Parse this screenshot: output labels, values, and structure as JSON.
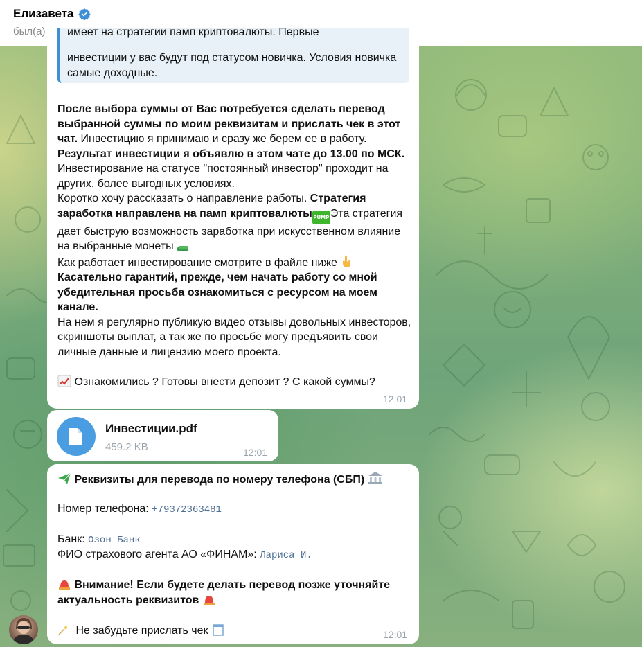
{
  "header": {
    "name": "Елизавета",
    "status": "был(а) недавно"
  },
  "message1": {
    "quote_cut_line": "имеет на стратегии памп криптовалюты. Первые",
    "quote_text": "инвестиции у вас будут под статусом новичка. Условия новичка самые доходные.",
    "p1_bold": "После выбора суммы от Вас потребуется сделать перевод выбранной суммы по моим реквизитам и прислать чек в этот чат.",
    "p1_rest": " Инвестицию я принимаю и сразу же берем ее в работу.",
    "p2_bold": "Результат инвестиции я объявлю в этом чате до 13.00 по МСК.",
    "p3": "Инвестирование на статусе \"постоянный инвестор\" проходит на других, более выгодных условиях.",
    "p4_start": "Коротко хочу рассказать о направление работы. ",
    "p4_bold": "Стратегия заработка направлена на памп криптовалюты",
    "pump_badge": "PUMP",
    "p4_rest": "Эта стратегия дает быструю возможность заработка при искусственном влияние на выбранные монеты",
    "p5_underlined": "Как работает инвестирование смотрите в файле ниже",
    "p6_bold": "Касательно гарантий, прежде, чем начать работу со мной убедительная просьба ознакомиться с ресурсом на моем канале.",
    "p7": "На нем я регулярно публикую видео отзывы довольных инвесторов, скриншоты выплат, а так же по просьбе могу предъявить свои личные данные и лицензию моего проекта.",
    "p8": "Ознакомились ? Готовы внести депозит ? С какой суммы?",
    "time": "12:01"
  },
  "file_message": {
    "file_name": "Инвестиции.pdf",
    "file_size": "459.2 KB",
    "time": "12:01"
  },
  "message3": {
    "title": "Реквизиты для перевода по номеру телефона (СБП)",
    "phone_label": "Номер телефона: ",
    "phone_value": "+79372363481",
    "bank_label": "Банк: ",
    "bank_value": "Озон Банк",
    "agent_label": "ФИО страхового агента АО «ФИНАМ»: ",
    "agent_value": "Лариса И.",
    "warning": "Внимание! Если будете делать перевод позже уточняйте актуальность реквизитов",
    "reminder": "Не забудьте прислать чек",
    "time": "12:01"
  },
  "colors": {
    "accent": "#3e8fd6",
    "bubble": "#ffffff",
    "quote_bg": "#e8f1f7",
    "muted": "#9ba4ad",
    "mono_link": "#4d6f95",
    "pump_green": "#3fb52e"
  }
}
